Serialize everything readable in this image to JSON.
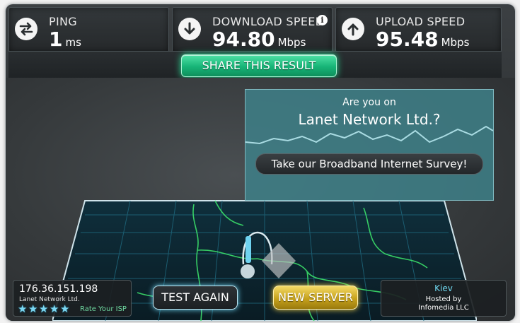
{
  "header": {
    "ping": {
      "label": "PING",
      "value": "1",
      "unit": "ms",
      "icon": "ping-arrows-icon"
    },
    "download": {
      "label": "DOWNLOAD SPEED",
      "value": "94.80",
      "unit": "Mbps",
      "icon": "download-arrow-icon",
      "info": "i"
    },
    "upload": {
      "label": "UPLOAD SPEED",
      "value": "95.48",
      "unit": "Mbps",
      "icon": "upload-arrow-icon"
    }
  },
  "share": {
    "label": "SHARE THIS RESULT"
  },
  "survey": {
    "question": "Are you on",
    "isp": "Lanet Network Ltd.?",
    "button": "Take our Broadband Internet Survey!"
  },
  "footer": {
    "ip": "176.36.151.198",
    "isp_name": "Lanet Network Ltd.",
    "rate_label": "Rate Your ISP",
    "stars": 5,
    "test_again": "TEST AGAIN",
    "new_server": "NEW SERVER",
    "server_city": "Kiev",
    "hosted_by": "Hosted by",
    "host_name": "Infomedia LLC"
  },
  "colors": {
    "accent_green": "#17b477",
    "accent_blue": "#6fd3f0",
    "accent_gold": "#c7a21c",
    "map_line_green": "#3be06a"
  }
}
